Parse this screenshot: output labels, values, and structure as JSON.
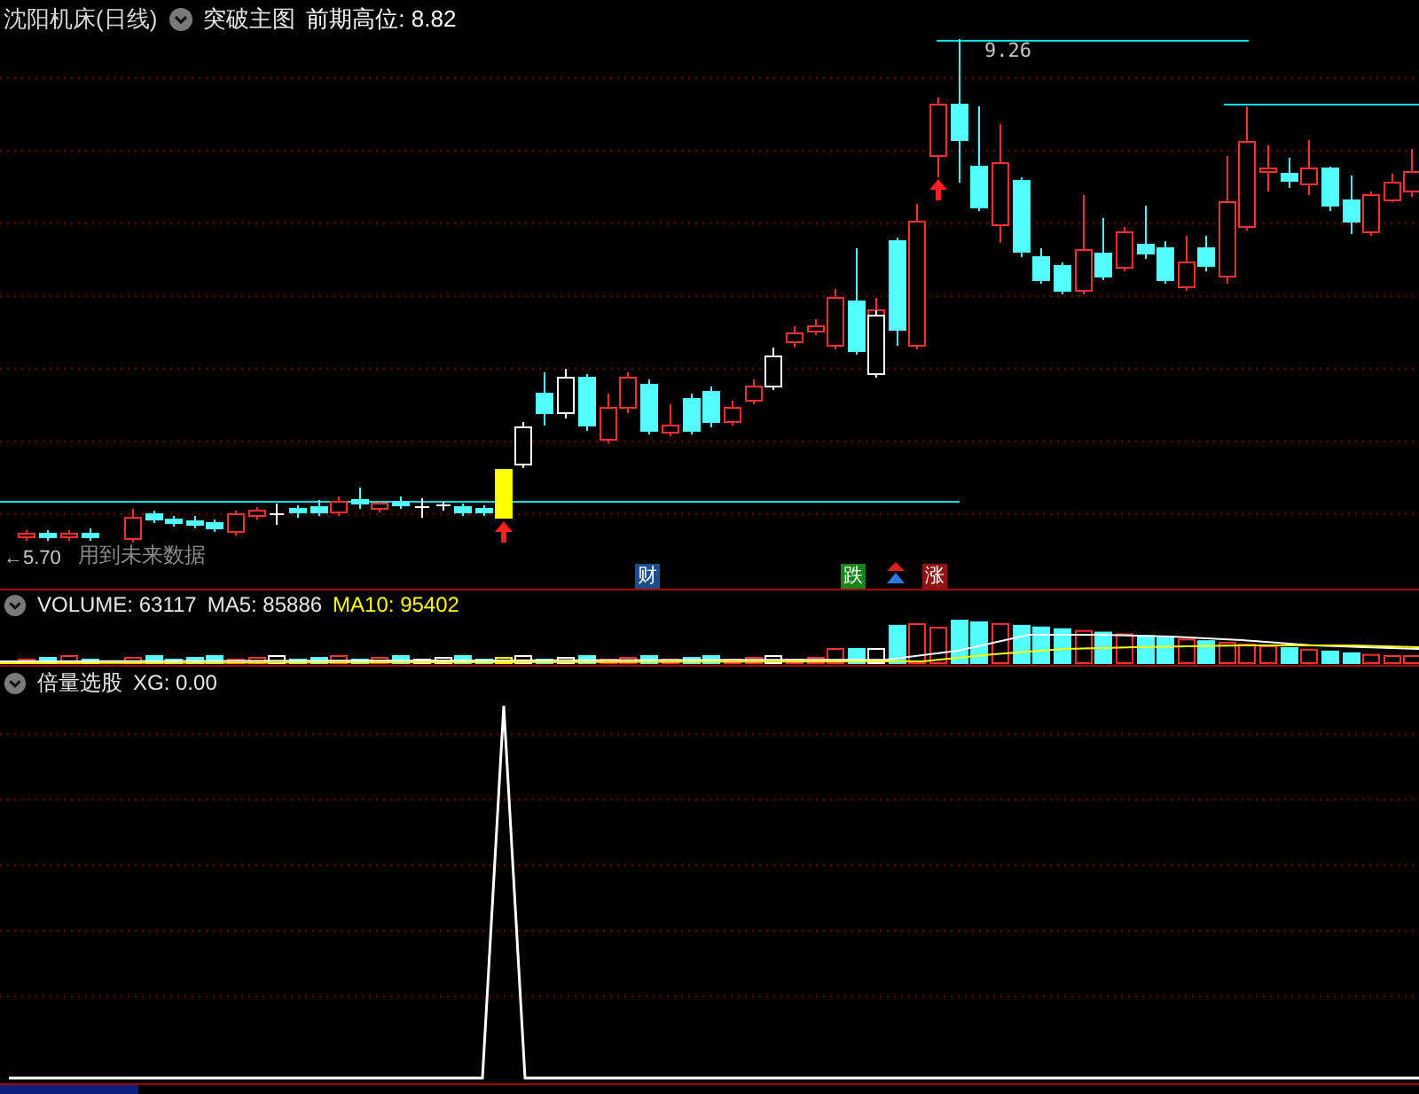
{
  "main_chart": {
    "title": "沈阳机床(日线)",
    "indicator": "突破主图",
    "readout": "前期高位: 8.82",
    "high_label": "9.26",
    "low_label": "←5.70",
    "warning": "用到未来数据",
    "event_badges": [
      {
        "text": "财",
        "color": "#1b4f8c"
      },
      {
        "text": "跌",
        "color": "#16861c"
      },
      {
        "text": "涨",
        "color": "#8c1414"
      }
    ]
  },
  "volume_panel": {
    "readouts": [
      {
        "text": "VOLUME: 63117",
        "color": "#e6e6e6"
      },
      {
        "text": "MA5: 85886",
        "color": "#e6e6e6"
      },
      {
        "text": "MA10: 95402",
        "color": "#ffff00"
      }
    ]
  },
  "signal_panel": {
    "title": "倍量选股",
    "readout": "XG: 0.00"
  }
}
